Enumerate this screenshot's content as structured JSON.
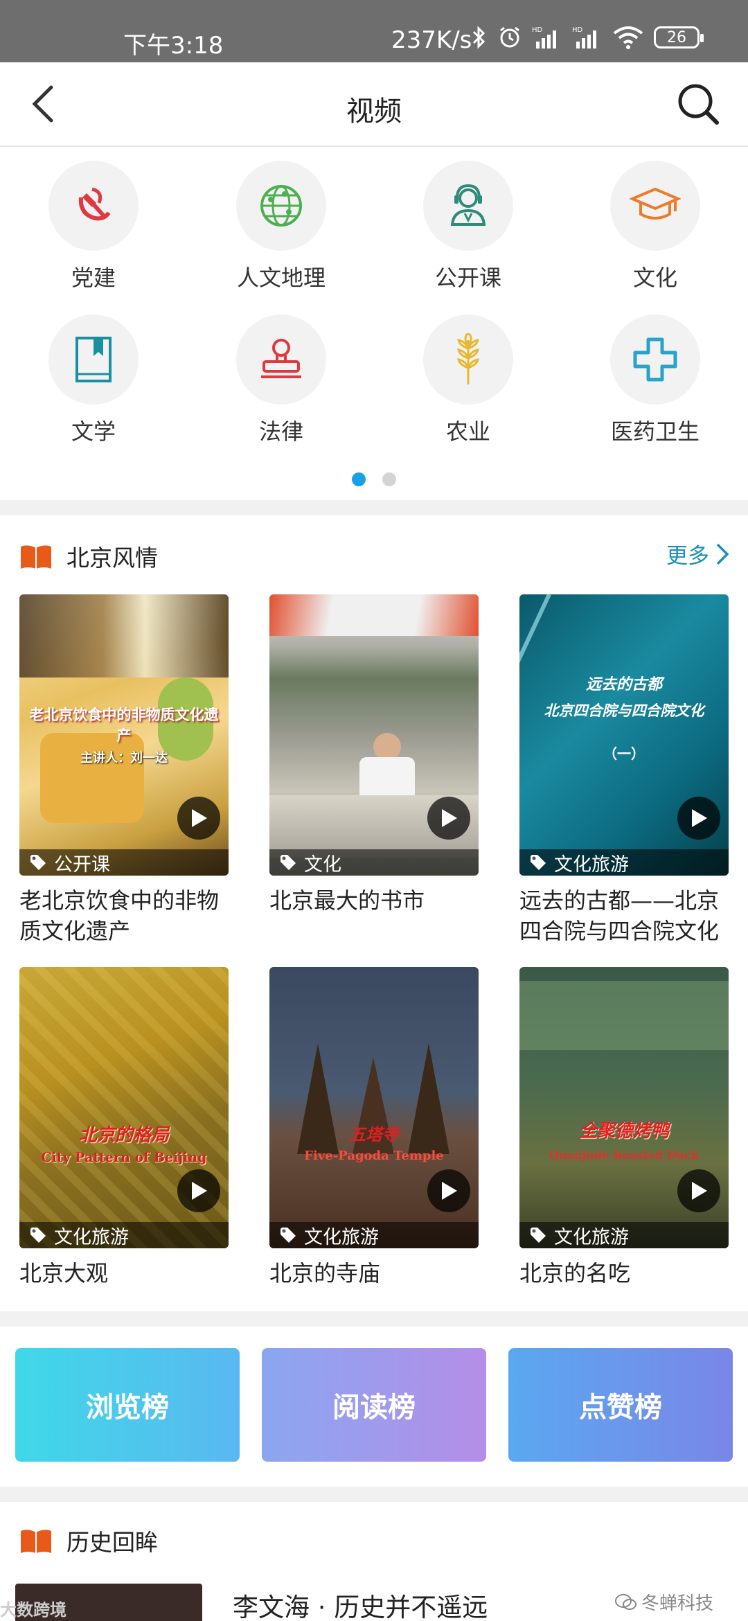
{
  "status": {
    "time": "下午3:18",
    "speed": "237K/s",
    "battery": "26"
  },
  "header": {
    "title": "视频"
  },
  "categories": [
    {
      "label": "党建",
      "icon": "hammer-sickle-icon",
      "color": "#e0383e"
    },
    {
      "label": "人文地理",
      "icon": "globe-icon",
      "color": "#4caf50"
    },
    {
      "label": "公开课",
      "icon": "headset-teacher-icon",
      "color": "#2e8b7a"
    },
    {
      "label": "文化",
      "icon": "graduation-cap-icon",
      "color": "#f07a2a"
    },
    {
      "label": "文学",
      "icon": "bookmark-book-icon",
      "color": "#1a8fa0"
    },
    {
      "label": "法律",
      "icon": "stamp-icon",
      "color": "#e0383e"
    },
    {
      "label": "农业",
      "icon": "wheat-icon",
      "color": "#e8b830"
    },
    {
      "label": "医药卫生",
      "icon": "medical-cross-icon",
      "color": "#2aa3c8"
    }
  ],
  "section1": {
    "title": "北京风情",
    "more": "更多",
    "videos": [
      {
        "title": "老北京饮食中的非物质文化遗产",
        "tag": "公开课",
        "overlay": "老北京饮食中的非物质文化遗产",
        "overlay2": "主讲人：刘一达"
      },
      {
        "title": "北京最大的书市",
        "tag": "文化",
        "overlay": "",
        "overlay2": ""
      },
      {
        "title": "远去的古都——北京四合院与四合院文化",
        "tag": "文化旅游",
        "overlay": "远去的古都",
        "overlay2": "北京四合院与四合院文化",
        "overlay3": "（一）"
      },
      {
        "title": "北京大观",
        "tag": "文化旅游",
        "overlay": "北京的格局",
        "overlay2": "City Pattern of Beijing"
      },
      {
        "title": "北京的寺庙",
        "tag": "文化旅游",
        "overlay": "五塔寺",
        "overlay2": "Five-Pagoda Temple"
      },
      {
        "title": "北京的名吃",
        "tag": "文化旅游",
        "overlay": "全聚德烤鸭",
        "overlay2": "Quanjude Roasted Duck"
      }
    ]
  },
  "rankings": [
    {
      "label": "浏览榜",
      "color_from": "#3fd8e8",
      "color_to": "#5ab8f0"
    },
    {
      "label": "阅读榜",
      "color_from": "#8aa6f0",
      "color_to": "#b48ee8"
    },
    {
      "label": "点赞榜",
      "color_from": "#5aa8f0",
      "color_to": "#7a86e8"
    }
  ],
  "section2": {
    "title": "历史回眸",
    "first_item": "李文海 · 历史并不遥远"
  },
  "watermark": {
    "left": "大数跨境",
    "right": "冬蝉科技"
  }
}
